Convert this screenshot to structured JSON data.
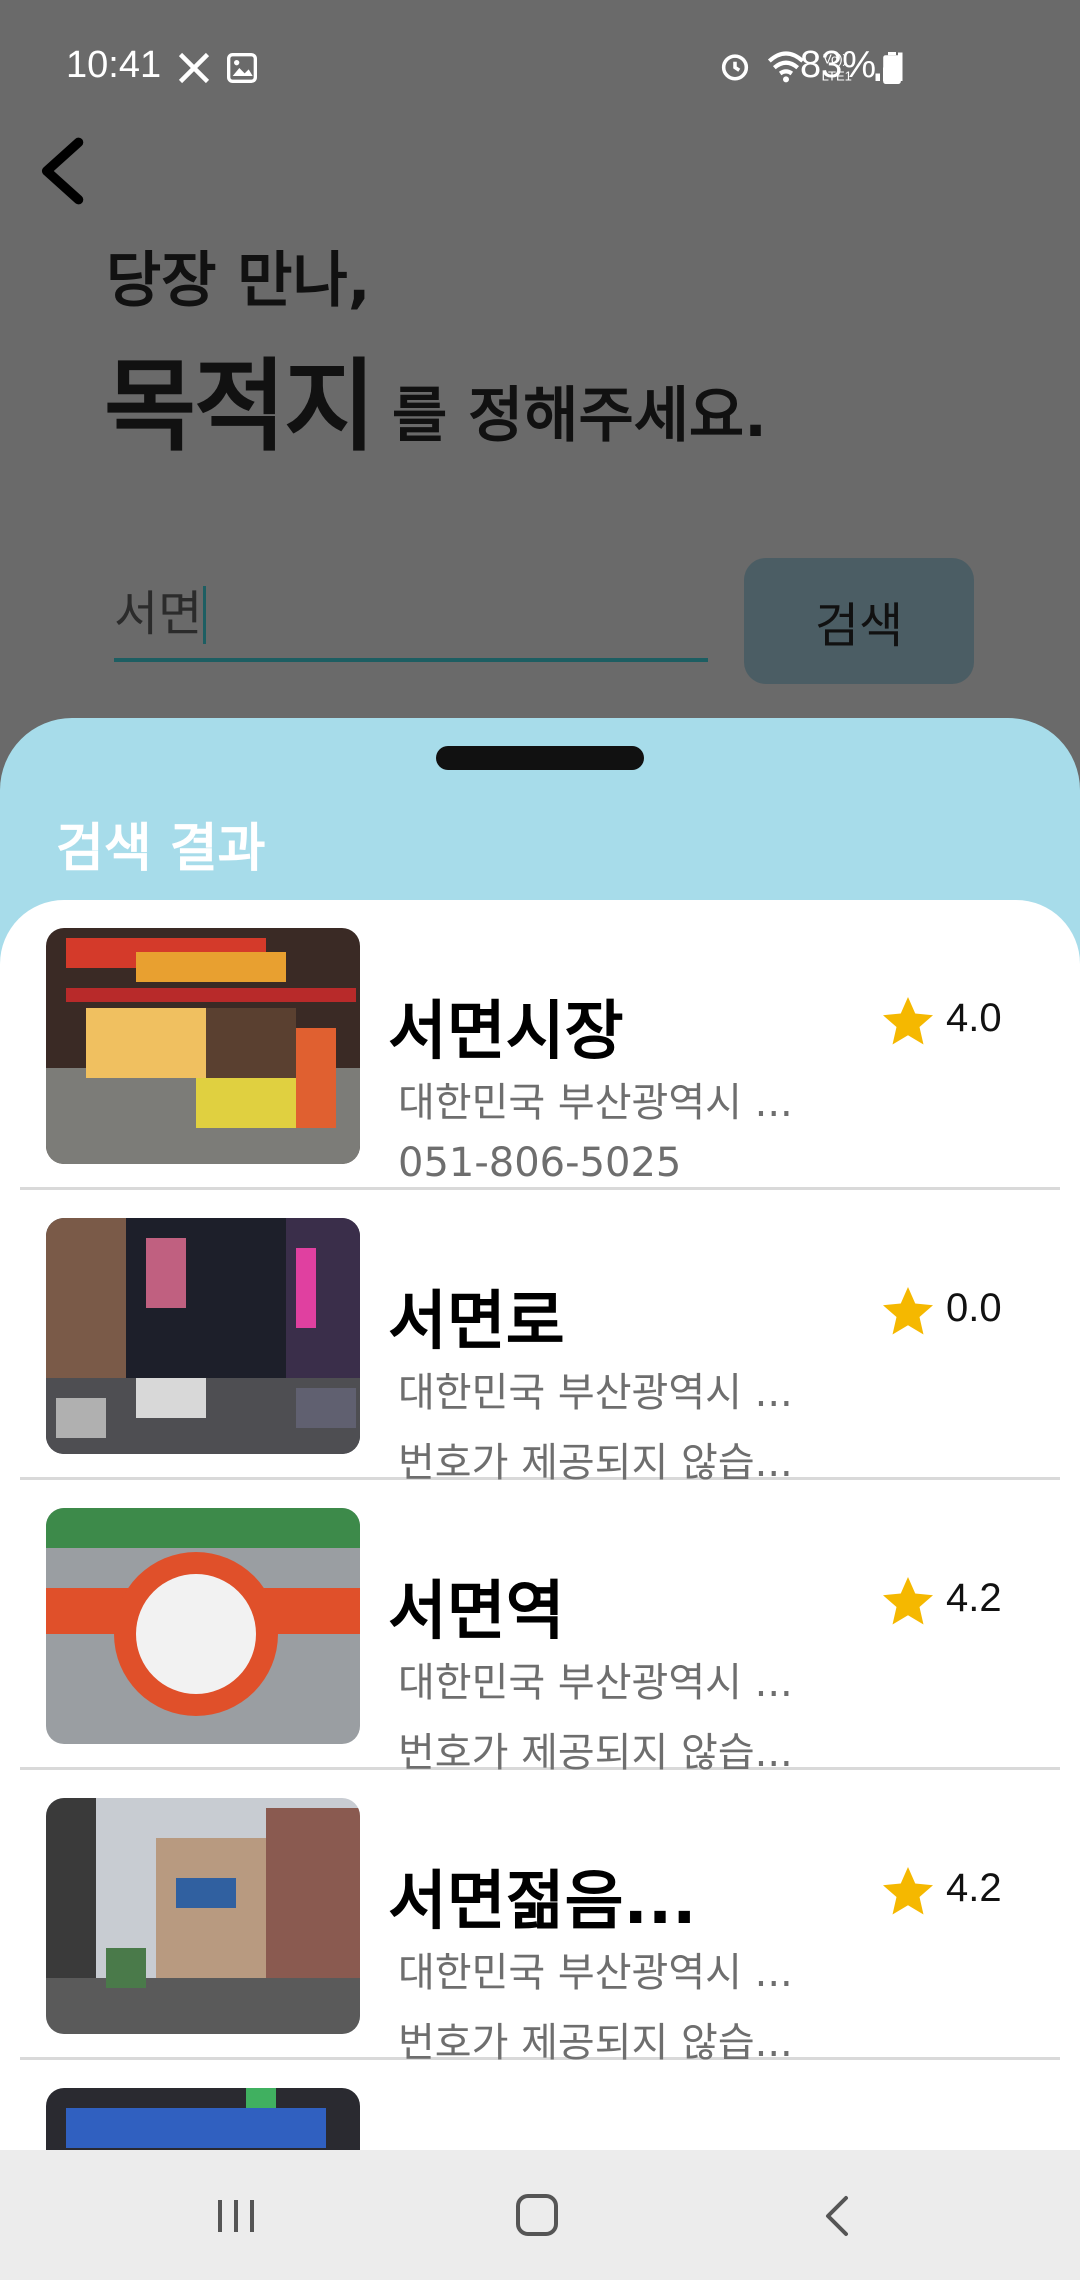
{
  "status_bar": {
    "time": "10:41",
    "battery": "83%"
  },
  "header": {
    "line1": "당장 만나,",
    "line2_main": "목적지",
    "line2_sub": "를 정해주세요."
  },
  "search": {
    "value": "서면",
    "button_label": "검색"
  },
  "results": {
    "title": "검색 결과",
    "items": [
      {
        "name": "서면시장",
        "address": "대한민국 부산광역시 ...",
        "phone": "051-806-5025",
        "rating": "4.0"
      },
      {
        "name": "서면로",
        "address": "대한민국 부산광역시 ...",
        "phone": "번호가 제공되지 않습...",
        "rating": "0.0"
      },
      {
        "name": "서면역",
        "address": "대한민국 부산광역시 ...",
        "phone": "번호가 제공되지 않습...",
        "rating": "4.2"
      },
      {
        "name": "서면젊음...",
        "address": "대한민국 부산광역시 ...",
        "phone": "번호가 제공되지 않습...",
        "rating": "4.2"
      }
    ]
  },
  "colors": {
    "overlay": "#6a6a6a",
    "sheet": "#a7dcea",
    "accent": "#1d5e62",
    "star": "#f5b800"
  }
}
